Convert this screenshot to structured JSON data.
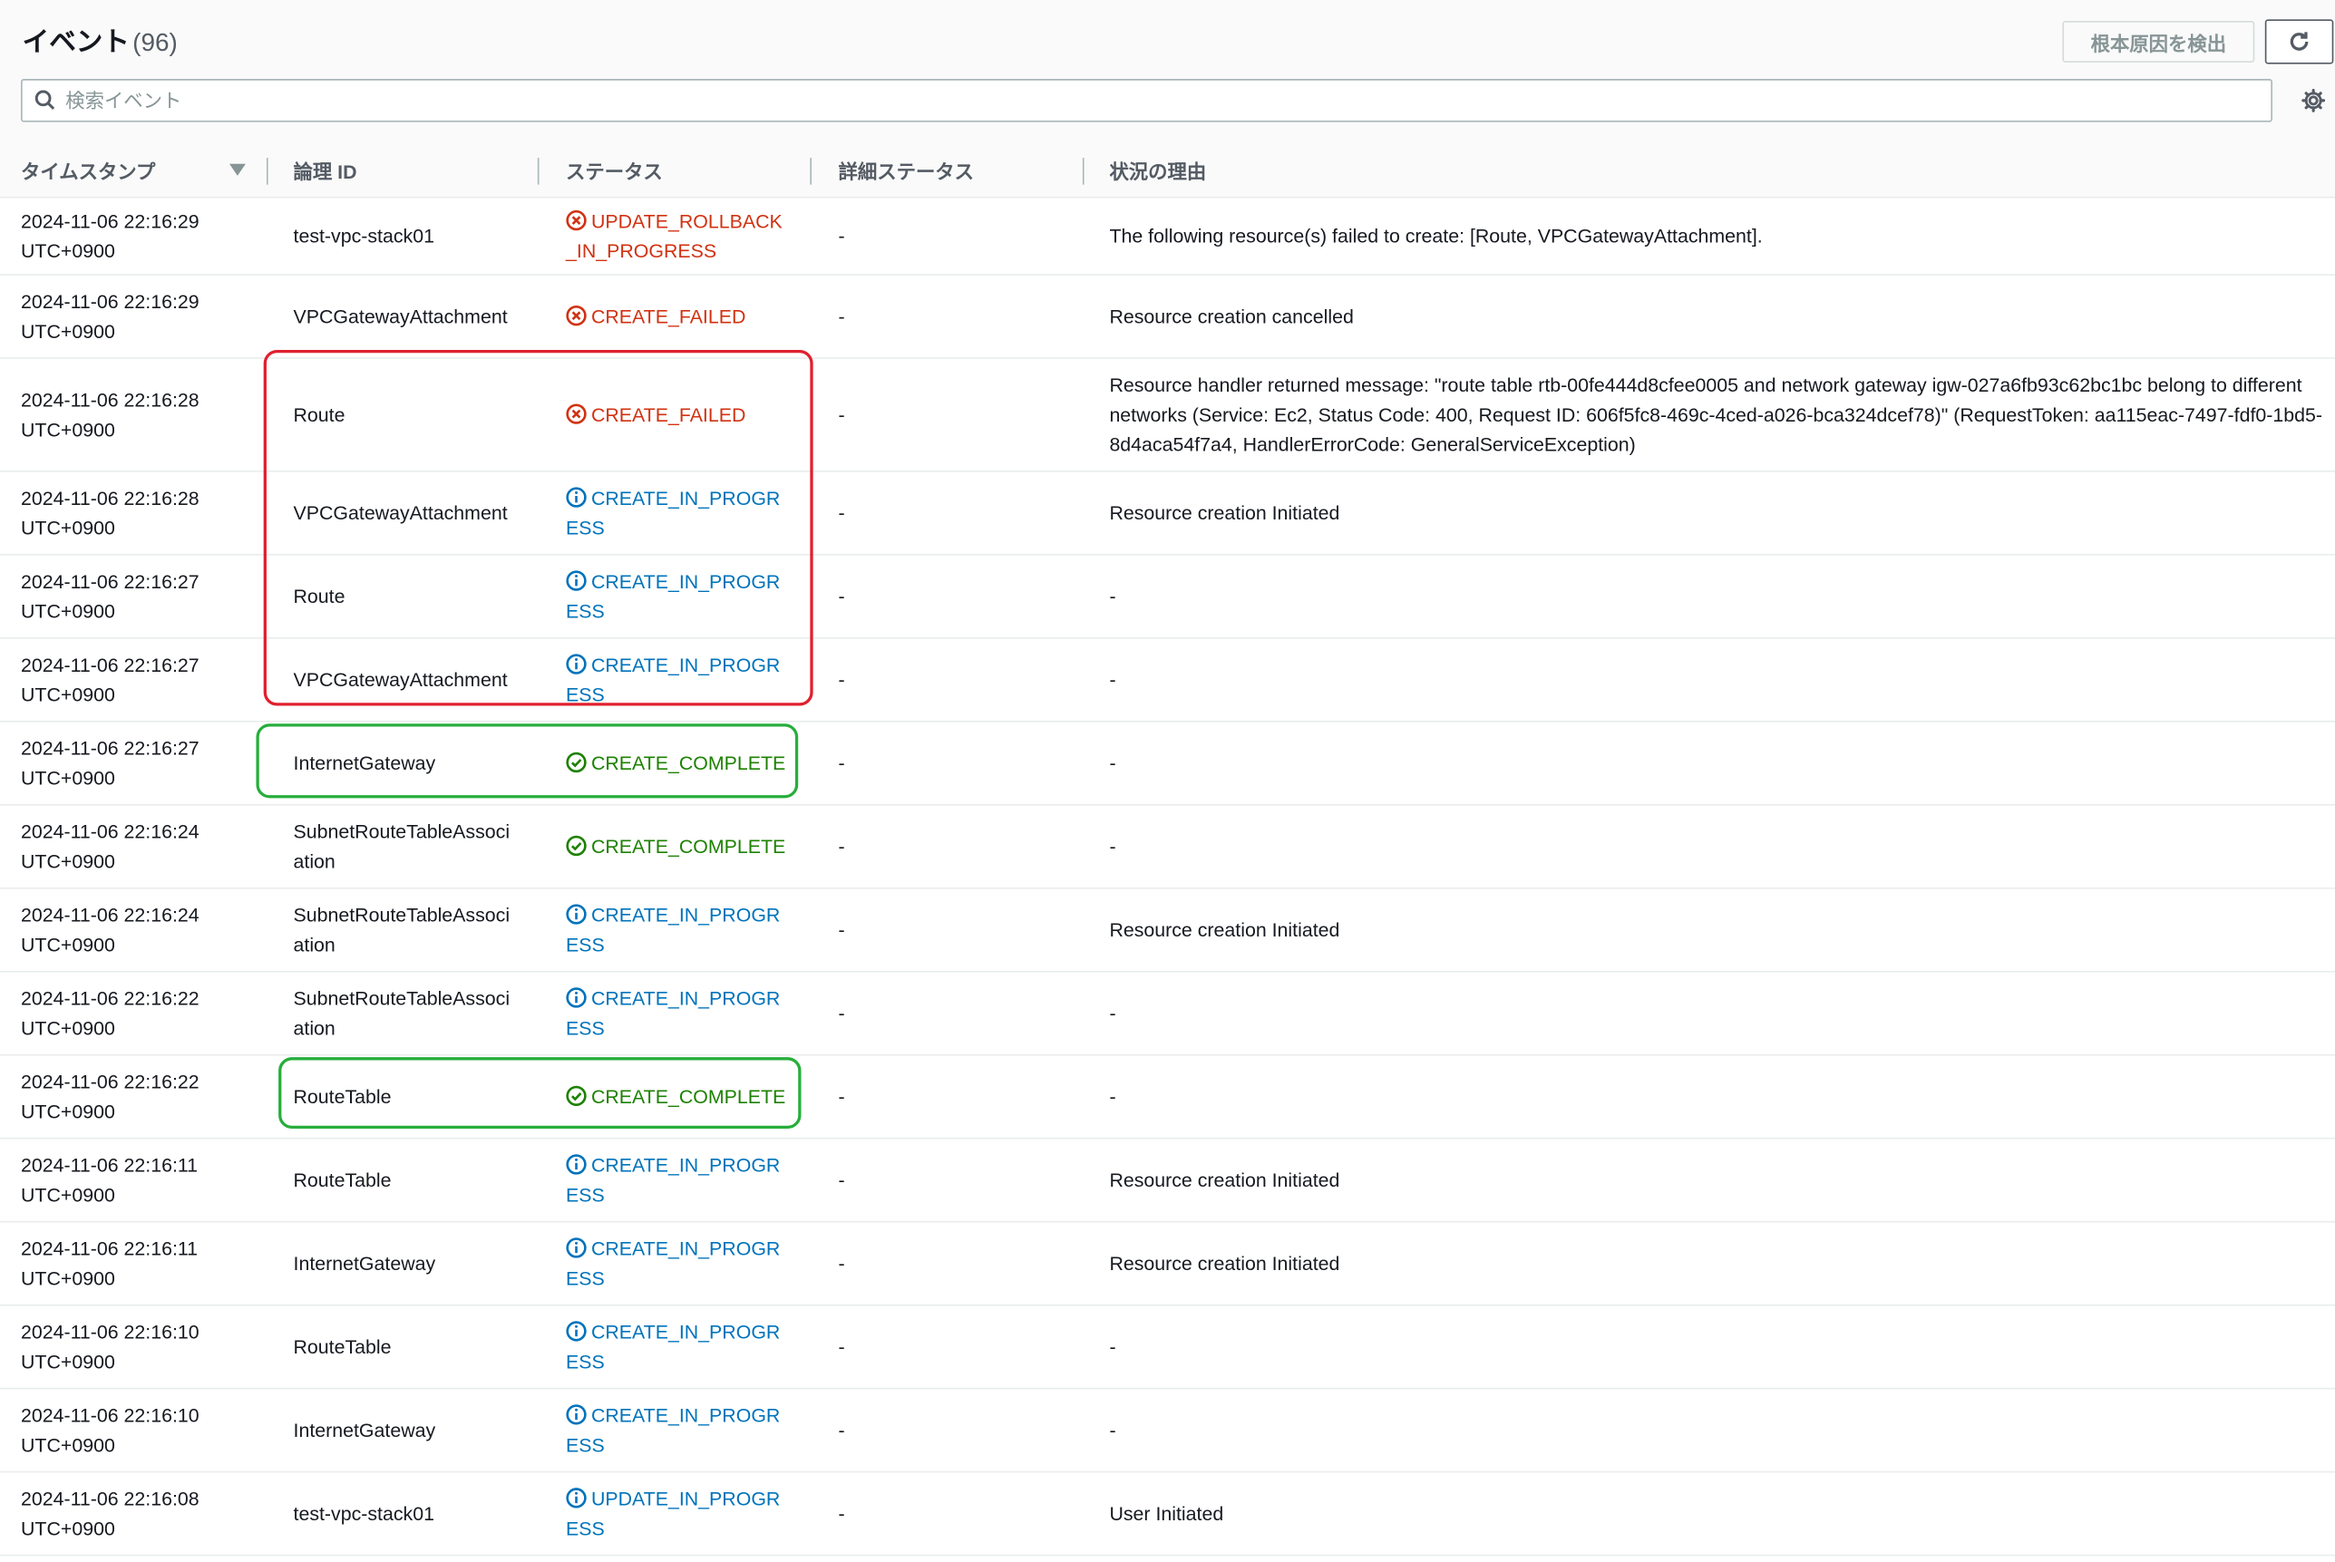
{
  "header": {
    "title": "イベント",
    "count": "(96)",
    "rca_button": "根本原因を検出"
  },
  "search": {
    "placeholder": "検索イベント"
  },
  "columns": {
    "timestamp": "タイムスタンプ",
    "logical_id": "論理 ID",
    "status": "ステータス",
    "detailed_status": "詳細ステータス",
    "reason": "状況の理由"
  },
  "colors": {
    "failed": "#d13212",
    "in_progress": "#0073bb",
    "complete": "#1d8102",
    "highlight_red": "#e0202e",
    "highlight_green": "#27ae3c"
  },
  "rows": [
    {
      "ts1": "2024-11-06 22:16:29",
      "ts2": "UTC+0900",
      "lid": "test-vpc-stack01",
      "status": "UPDATE_ROLLBACK_IN_PROGRESS",
      "kind": "failed",
      "detail": "-",
      "reason": "The following resource(s) failed to create: [Route, VPCGatewayAttachment]."
    },
    {
      "ts1": "2024-11-06 22:16:29",
      "ts2": "UTC+0900",
      "lid": "VPCGatewayAttachment",
      "status": "CREATE_FAILED",
      "kind": "failed",
      "detail": "-",
      "reason": "Resource creation cancelled"
    },
    {
      "ts1": "2024-11-06 22:16:28",
      "ts2": "UTC+0900",
      "lid": "Route",
      "status": "CREATE_FAILED",
      "kind": "failed",
      "detail": "-",
      "reason": "Resource handler returned message: \"route table rtb-00fe444d8cfee0005 and network gateway igw-027a6fb93c62bc1bc belong to different networks (Service: Ec2, Status Code: 400, Request ID: 606f5fc8-469c-4ced-a026-bca324dcef78)\" (RequestToken: aa115eac-7497-fdf0-1bd5-8d4aca54f7a4, HandlerErrorCode: GeneralServiceException)"
    },
    {
      "ts1": "2024-11-06 22:16:28",
      "ts2": "UTC+0900",
      "lid": "VPCGatewayAttachment",
      "status": "CREATE_IN_PROGRESS",
      "kind": "progress",
      "detail": "-",
      "reason": "Resource creation Initiated"
    },
    {
      "ts1": "2024-11-06 22:16:27",
      "ts2": "UTC+0900",
      "lid": "Route",
      "status": "CREATE_IN_PROGRESS",
      "kind": "progress",
      "detail": "-",
      "reason": "-"
    },
    {
      "ts1": "2024-11-06 22:16:27",
      "ts2": "UTC+0900",
      "lid": "VPCGatewayAttachment",
      "status": "CREATE_IN_PROGRESS",
      "kind": "progress",
      "detail": "-",
      "reason": "-"
    },
    {
      "ts1": "2024-11-06 22:16:27",
      "ts2": "UTC+0900",
      "lid": "InternetGateway",
      "status": "CREATE_COMPLETE",
      "kind": "complete",
      "detail": "-",
      "reason": "-"
    },
    {
      "ts1": "2024-11-06 22:16:24",
      "ts2": "UTC+0900",
      "lid": "SubnetRouteTableAssociation",
      "status": "CREATE_COMPLETE",
      "kind": "complete",
      "detail": "-",
      "reason": "-"
    },
    {
      "ts1": "2024-11-06 22:16:24",
      "ts2": "UTC+0900",
      "lid": "SubnetRouteTableAssociation",
      "status": "CREATE_IN_PROGRESS",
      "kind": "progress",
      "detail": "-",
      "reason": "Resource creation Initiated"
    },
    {
      "ts1": "2024-11-06 22:16:22",
      "ts2": "UTC+0900",
      "lid": "SubnetRouteTableAssociation",
      "status": "CREATE_IN_PROGRESS",
      "kind": "progress",
      "detail": "-",
      "reason": "-"
    },
    {
      "ts1": "2024-11-06 22:16:22",
      "ts2": "UTC+0900",
      "lid": "RouteTable",
      "status": "CREATE_COMPLETE",
      "kind": "complete",
      "detail": "-",
      "reason": "-"
    },
    {
      "ts1": "2024-11-06 22:16:11",
      "ts2": "UTC+0900",
      "lid": "RouteTable",
      "status": "CREATE_IN_PROGRESS",
      "kind": "progress",
      "detail": "-",
      "reason": "Resource creation Initiated"
    },
    {
      "ts1": "2024-11-06 22:16:11",
      "ts2": "UTC+0900",
      "lid": "InternetGateway",
      "status": "CREATE_IN_PROGRESS",
      "kind": "progress",
      "detail": "-",
      "reason": "Resource creation Initiated"
    },
    {
      "ts1": "2024-11-06 22:16:10",
      "ts2": "UTC+0900",
      "lid": "RouteTable",
      "status": "CREATE_IN_PROGRESS",
      "kind": "progress",
      "detail": "-",
      "reason": "-"
    },
    {
      "ts1": "2024-11-06 22:16:10",
      "ts2": "UTC+0900",
      "lid": "InternetGateway",
      "status": "CREATE_IN_PROGRESS",
      "kind": "progress",
      "detail": "-",
      "reason": "-"
    },
    {
      "ts1": "2024-11-06 22:16:08",
      "ts2": "UTC+0900",
      "lid": "test-vpc-stack01",
      "status": "UPDATE_IN_PROGRESS",
      "kind": "progress",
      "detail": "-",
      "reason": "User Initiated"
    }
  ]
}
